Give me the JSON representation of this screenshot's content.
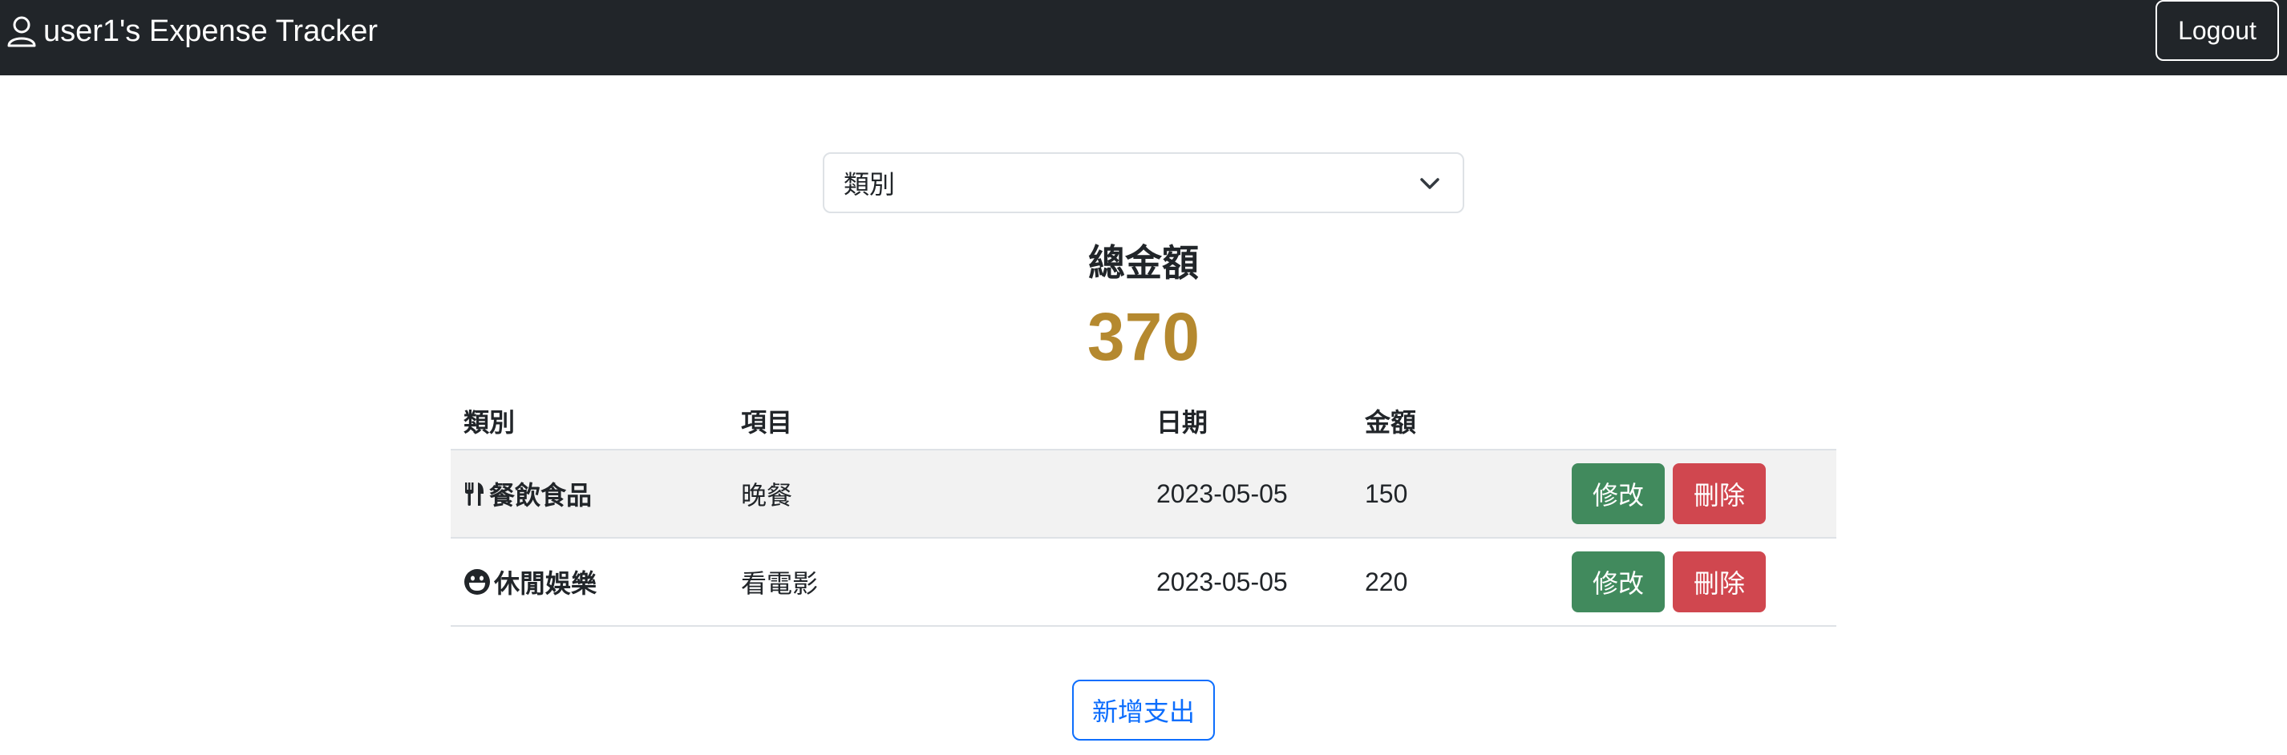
{
  "header": {
    "brand_icon": "person-icon",
    "title": "user1's Expense Tracker",
    "logout_label": "Logout"
  },
  "filter": {
    "selected": "類別",
    "icon": "chevron-down-icon"
  },
  "summary": {
    "label": "總金額",
    "value": "370",
    "value_color": "#b5892f"
  },
  "table": {
    "columns": [
      "類別",
      "項目",
      "日期",
      "金額",
      ""
    ],
    "rows": [
      {
        "category_icon": "utensils-icon",
        "category": "餐飲食品",
        "item": "晚餐",
        "date": "2023-05-05",
        "amount": "150",
        "edit_label": "修改",
        "delete_label": "刪除"
      },
      {
        "category_icon": "grin-icon",
        "category": "休閒娛樂",
        "item": "看電影",
        "date": "2023-05-05",
        "amount": "220",
        "edit_label": "修改",
        "delete_label": "刪除"
      }
    ]
  },
  "actions": {
    "add_label": "新增支出"
  },
  "colors": {
    "navbar": "#212529",
    "edit": "#418a5d",
    "delete": "#d0474f",
    "primary": "#0d6efd"
  }
}
